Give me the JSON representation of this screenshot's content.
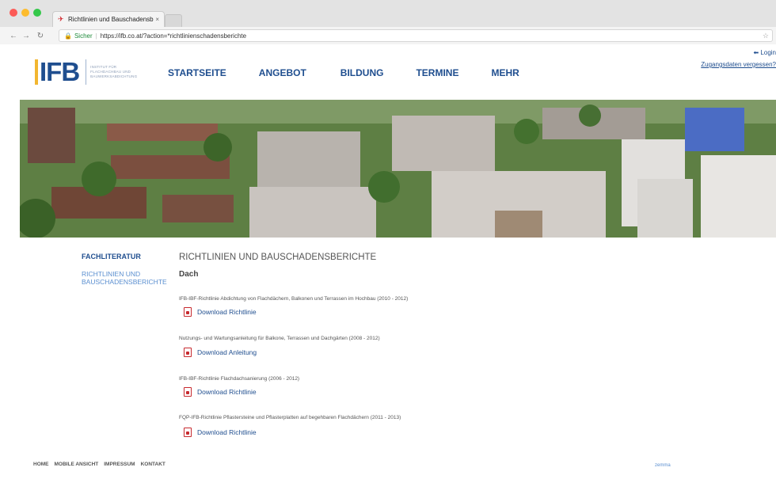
{
  "browser": {
    "tab_title": "Richtlinien und Bauschadensb",
    "tab_close": "×",
    "secure_label": "Sicher",
    "url": "https://ifb.co.at/?action=*richtlinienschadensberichte"
  },
  "site": {
    "logo_text": "IFB",
    "logo_sub": [
      "INSTITUT FÜR",
      "FLACHDACHBAU UND",
      "BAUWERKSABDICHTUNG"
    ],
    "nav": [
      "STARTSEITE",
      "ANGEBOT",
      "BILDUNG",
      "TERMINE",
      "MEHR"
    ],
    "login": "Login",
    "forgot": "Zugangsdaten vergessen?"
  },
  "sidebar": {
    "item1": "FACHLITERATUR",
    "item2": "RICHTLINIEN UND BAUSCHADENSBERICHTE"
  },
  "main": {
    "title": "RICHTLINIEN UND BAUSCHADENSBERICHTE",
    "section": "Dach",
    "items": [
      {
        "title": "IFB-IBF-Richtlinie Abdichtung von Flachdächern, Balkonen und Terrassen im Hochbau (2010 - 2012)",
        "link": "Download Richtlinie"
      },
      {
        "title": "Nutzungs- und Wartungsanleitung für Balkone, Terrassen und Dachgärten (2008 - 2012)",
        "link": "Download Anleitung"
      },
      {
        "title": "IFB-IBF-Richtlinie Flachdachsanierung (2006 - 2012)",
        "link": "Download Richtlinie"
      },
      {
        "title": "FQP-IFB-Richtlinie Pflastersteine und Pflasterplatten auf begehbaren Flachdächern (2011 - 2013)",
        "link": "Download Richtlinie"
      }
    ]
  },
  "footer": {
    "links": [
      "HOME",
      "MOBILE ANSICHT",
      "IMPRESSUM",
      "KONTAKT"
    ],
    "brand": "zemma"
  }
}
